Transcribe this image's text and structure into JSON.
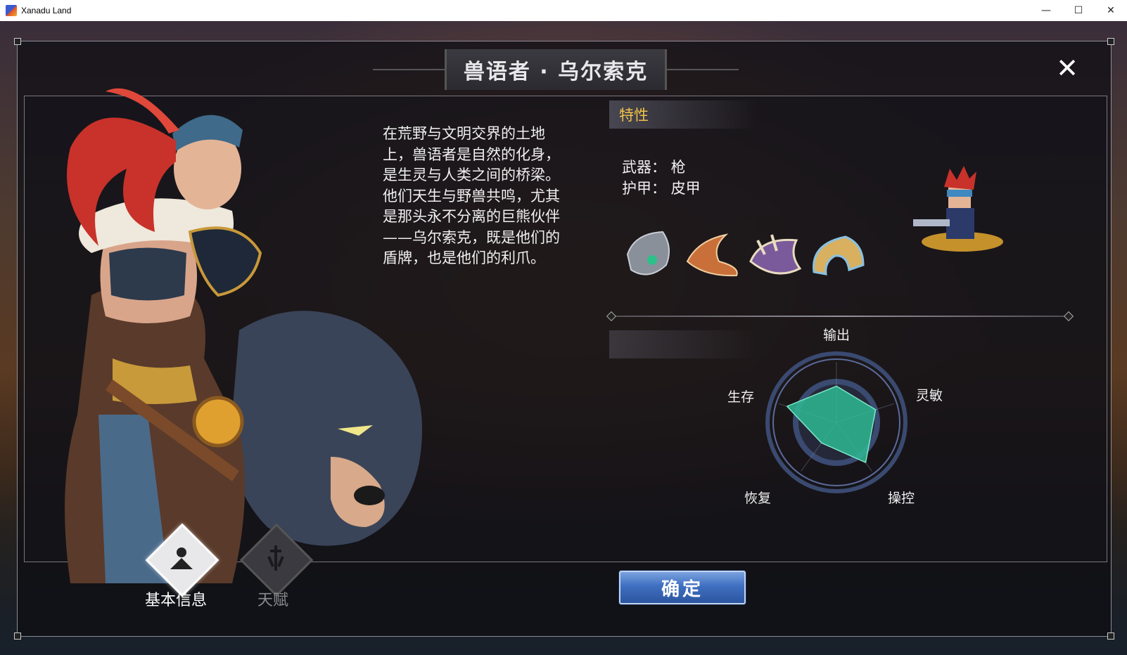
{
  "window": {
    "title": "Xanadu Land",
    "minimize_glyph": "—",
    "maximize_glyph": "☐",
    "close_glyph": "✕"
  },
  "dialog": {
    "title": "兽语者 · 乌尔索克",
    "close_glyph": "✕",
    "description": "在荒野与文明交界的土地上，兽语者是自然的化身，是生灵与人类之间的桥梁。他们天生与野兽共鸣，尤其是那头永不分离的巨熊伙伴——乌尔索克，既是他们的盾牌，也是他们的利爪。",
    "traits": {
      "header": "特性",
      "weapon_line": "武器：  枪",
      "armor_line": "护甲：  皮甲",
      "items": [
        "amulet-icon",
        "horn-icon",
        "bone-horn-icon",
        "crescent-horn-icon"
      ]
    },
    "radar": {
      "labels": {
        "output": "输出",
        "agility": "灵敏",
        "control": "操控",
        "recovery": "恢复",
        "survival": "生存"
      },
      "fill_color": "#2fb894"
    },
    "tabs": [
      {
        "label": "基本信息",
        "active": true
      },
      {
        "label": "天赋",
        "active": false
      }
    ],
    "confirm_label": "确定"
  },
  "chart_data": {
    "type": "radar",
    "categories": [
      "输出",
      "灵敏",
      "操控",
      "恢复",
      "生存"
    ],
    "values": [
      0.6,
      0.68,
      0.82,
      0.42,
      0.86
    ],
    "max": 1
  }
}
